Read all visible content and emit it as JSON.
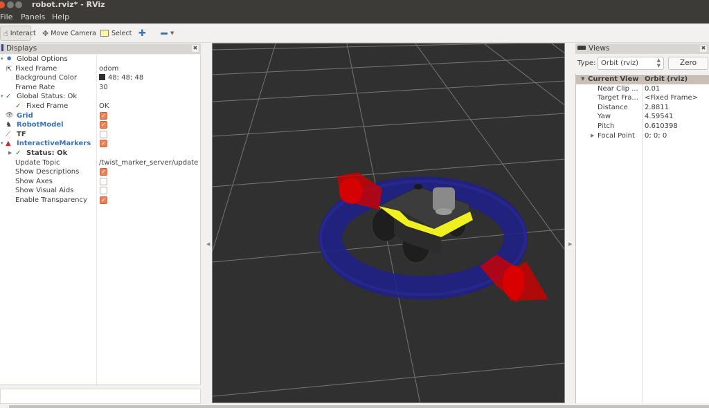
{
  "window": {
    "title": "robot.rviz* - RViz"
  },
  "menu": {
    "items": [
      {
        "label": "File",
        "mnemonic": "F"
      },
      {
        "label": "Panels",
        "mnemonic": "P"
      },
      {
        "label": "Help",
        "mnemonic": "H"
      }
    ]
  },
  "toolbar": {
    "interact": "Interact",
    "move_camera": "Move Camera",
    "select": "Select",
    "add_tool_icon": "plus-icon",
    "remove_tool_icon": "minus-icon"
  },
  "displays": {
    "title": "Displays",
    "rows": [
      {
        "name": "Global Options",
        "value": ""
      },
      {
        "name": "Fixed Frame",
        "value": "odom"
      },
      {
        "name": "Background Color",
        "value": "48; 48; 48",
        "swatch": "#303030"
      },
      {
        "name": "Frame Rate",
        "value": "30"
      },
      {
        "name": "Global Status: Ok",
        "value": ""
      },
      {
        "name": "Fixed Frame",
        "value": "OK"
      },
      {
        "name": "Grid",
        "checked": true
      },
      {
        "name": "RobotModel",
        "checked": true
      },
      {
        "name": "TF",
        "checked": false
      },
      {
        "name": "InteractiveMarkers",
        "checked": true
      },
      {
        "name": "Status: Ok",
        "value": ""
      },
      {
        "name": "Update Topic",
        "value": "/twist_marker_server/update"
      },
      {
        "name": "Show Descriptions",
        "checked": true
      },
      {
        "name": "Show Axes",
        "checked": false
      },
      {
        "name": "Show Visual Aids",
        "checked": false
      },
      {
        "name": "Enable Transparency",
        "checked": true
      }
    ]
  },
  "views": {
    "title": "Views",
    "type_label": "Type:",
    "type_value": "Orbit (rviz)",
    "zero_label": "Zero",
    "rows": [
      {
        "name": "Current View",
        "value": "Orbit (rviz)"
      },
      {
        "name": "Near Clip ...",
        "value": "0.01"
      },
      {
        "name": "Target Fra...",
        "value": "<Fixed Frame>"
      },
      {
        "name": "Distance",
        "value": "2.8811"
      },
      {
        "name": "Yaw",
        "value": "4.59541"
      },
      {
        "name": "Pitch",
        "value": "0.610398"
      },
      {
        "name": "Focal Point",
        "value": "0; 0; 0"
      }
    ]
  },
  "colors": {
    "viewport_bg": "#303030",
    "grid_line": "#8a8a8a",
    "ring": "#1e1e8c",
    "arrow": "#d00000",
    "robot_trim": "#f0f020",
    "checkbox_on": "#e8845c",
    "link_blue": "#3b73b9"
  }
}
